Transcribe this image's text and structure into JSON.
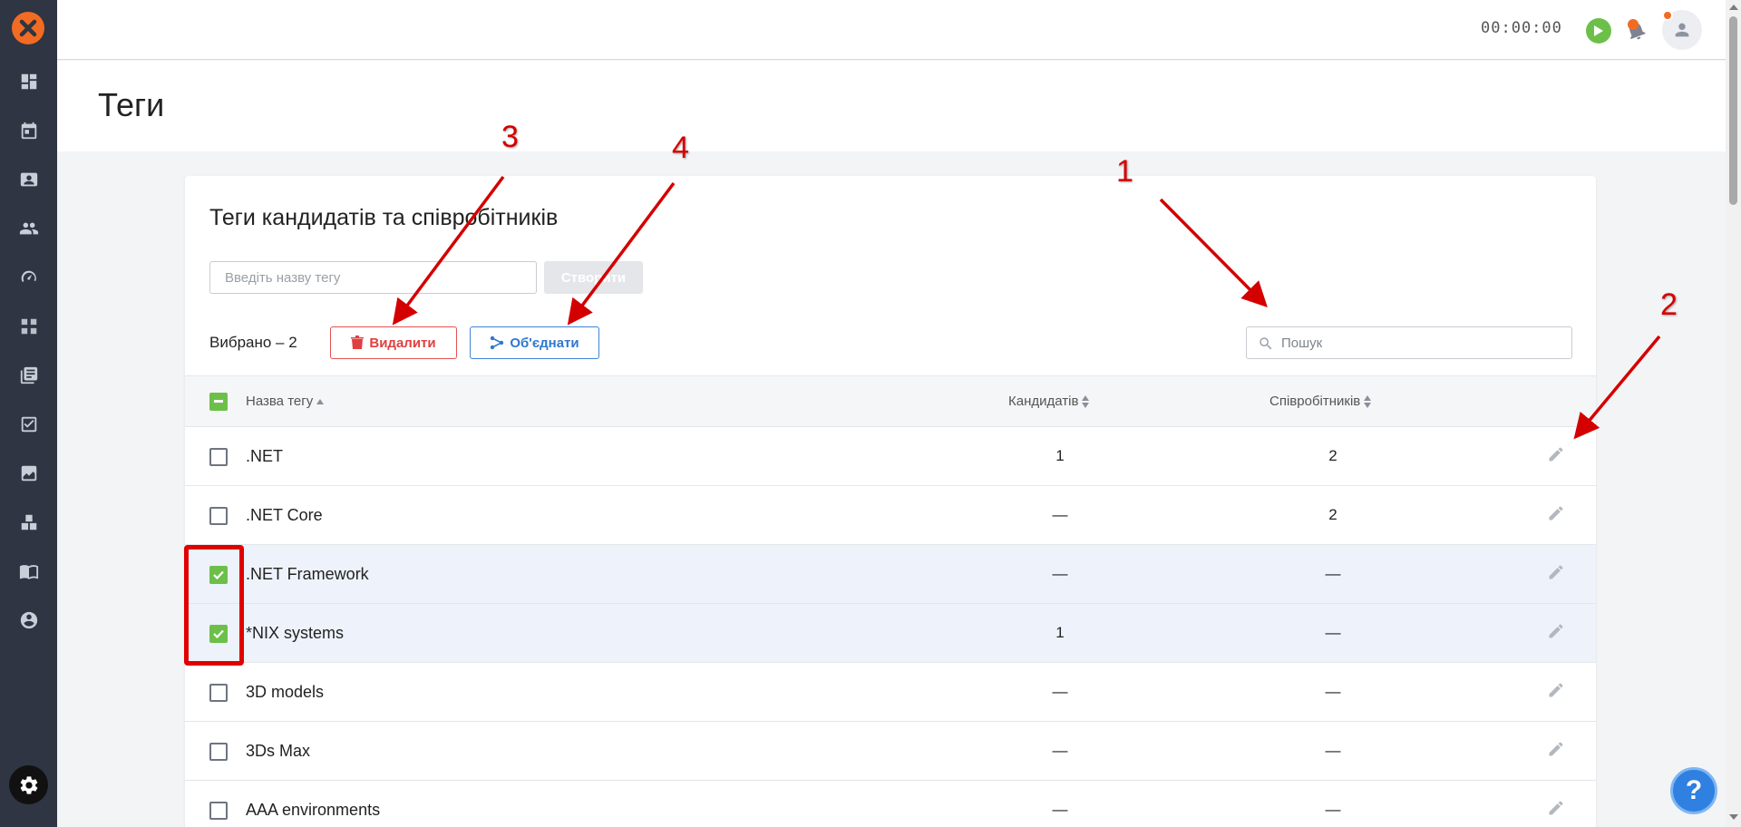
{
  "topbar": {
    "timer": "00:00:00"
  },
  "page": {
    "title": "Теги"
  },
  "card": {
    "title": "Теги кандидатів та співробітників",
    "tag_input_placeholder": "Введіть назву тегу",
    "create_label": "Створити",
    "selected_label": "Вибрано – 2",
    "delete_label": "Видалити",
    "merge_label": "Об'єднати",
    "search_placeholder": "Пошук"
  },
  "table": {
    "columns": {
      "name": "Назва тегу",
      "candidates": "Кандидатів",
      "employees": "Співробітників"
    },
    "rows": [
      {
        "name": ".NET",
        "candidates": "1",
        "employees": "2",
        "checked": false
      },
      {
        "name": ".NET Core",
        "candidates": "—",
        "employees": "2",
        "checked": false
      },
      {
        "name": ".NET Framework",
        "candidates": "—",
        "employees": "—",
        "checked": true
      },
      {
        "name": "*NIX systems",
        "candidates": "1",
        "employees": "—",
        "checked": true
      },
      {
        "name": "3D models",
        "candidates": "—",
        "employees": "—",
        "checked": false
      },
      {
        "name": "3Ds Max",
        "candidates": "—",
        "employees": "—",
        "checked": false
      },
      {
        "name": "AAA environments",
        "candidates": "—",
        "employees": "—",
        "checked": false
      }
    ]
  },
  "annotations": {
    "n1": "1",
    "n2": "2",
    "n3": "3",
    "n4": "4"
  },
  "help": {
    "label": "?"
  },
  "colors": {
    "sidebar": "#2f3542",
    "brand_orange": "#f26b22",
    "check_green": "#6cc04a",
    "delete_red": "#e04040",
    "merge_blue": "#2f78cf",
    "annotation_red": "#d40000"
  },
  "icons": {
    "sidebar": [
      "dashboard-icon",
      "calendar-icon",
      "contact-card-icon",
      "people-icon",
      "speedometer-icon",
      "workflow-icon",
      "library-icon",
      "task-check-icon",
      "chart-icon",
      "boxes-icon",
      "book-icon",
      "account-circle-icon"
    ]
  }
}
